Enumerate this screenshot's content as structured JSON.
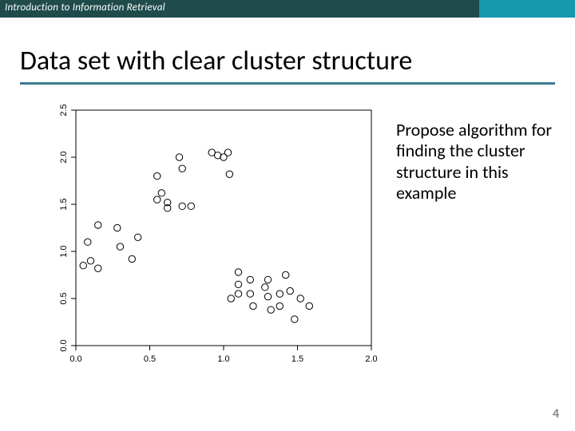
{
  "header": {
    "course": "Introduction to Information Retrieval"
  },
  "title": "Data set with clear cluster structure",
  "side_text": "Propose algorithm for finding the cluster structure in this example",
  "page_number": "4",
  "chart_data": {
    "type": "scatter",
    "title": "",
    "xlabel": "",
    "ylabel": "",
    "xlim": [
      0.0,
      2.0
    ],
    "ylim": [
      0.0,
      2.5
    ],
    "x_ticks": [
      0.0,
      0.5,
      1.0,
      1.5,
      2.0
    ],
    "y_ticks": [
      0.0,
      0.5,
      1.0,
      1.5,
      2.0,
      2.5
    ],
    "points": [
      {
        "x": 0.05,
        "y": 0.85
      },
      {
        "x": 0.1,
        "y": 0.9
      },
      {
        "x": 0.15,
        "y": 0.82
      },
      {
        "x": 0.08,
        "y": 1.1
      },
      {
        "x": 0.15,
        "y": 1.28
      },
      {
        "x": 0.28,
        "y": 1.25
      },
      {
        "x": 0.3,
        "y": 1.05
      },
      {
        "x": 0.38,
        "y": 0.92
      },
      {
        "x": 0.42,
        "y": 1.15
      },
      {
        "x": 0.55,
        "y": 1.55
      },
      {
        "x": 0.62,
        "y": 1.52
      },
      {
        "x": 0.62,
        "y": 1.46
      },
      {
        "x": 0.72,
        "y": 1.48
      },
      {
        "x": 0.78,
        "y": 1.48
      },
      {
        "x": 0.58,
        "y": 1.62
      },
      {
        "x": 0.55,
        "y": 1.8
      },
      {
        "x": 0.72,
        "y": 1.88
      },
      {
        "x": 0.7,
        "y": 2.0
      },
      {
        "x": 0.92,
        "y": 2.05
      },
      {
        "x": 0.96,
        "y": 2.02
      },
      {
        "x": 1.0,
        "y": 2.0
      },
      {
        "x": 1.03,
        "y": 2.05
      },
      {
        "x": 1.04,
        "y": 1.82
      },
      {
        "x": 1.05,
        "y": 0.5
      },
      {
        "x": 1.1,
        "y": 0.55
      },
      {
        "x": 1.1,
        "y": 0.65
      },
      {
        "x": 1.1,
        "y": 0.78
      },
      {
        "x": 1.18,
        "y": 0.7
      },
      {
        "x": 1.18,
        "y": 0.55
      },
      {
        "x": 1.2,
        "y": 0.42
      },
      {
        "x": 1.28,
        "y": 0.62
      },
      {
        "x": 1.3,
        "y": 0.7
      },
      {
        "x": 1.3,
        "y": 0.52
      },
      {
        "x": 1.32,
        "y": 0.38
      },
      {
        "x": 1.38,
        "y": 0.55
      },
      {
        "x": 1.38,
        "y": 0.42
      },
      {
        "x": 1.45,
        "y": 0.58
      },
      {
        "x": 1.48,
        "y": 0.28
      },
      {
        "x": 1.52,
        "y": 0.5
      },
      {
        "x": 1.58,
        "y": 0.42
      },
      {
        "x": 1.42,
        "y": 0.75
      }
    ]
  }
}
